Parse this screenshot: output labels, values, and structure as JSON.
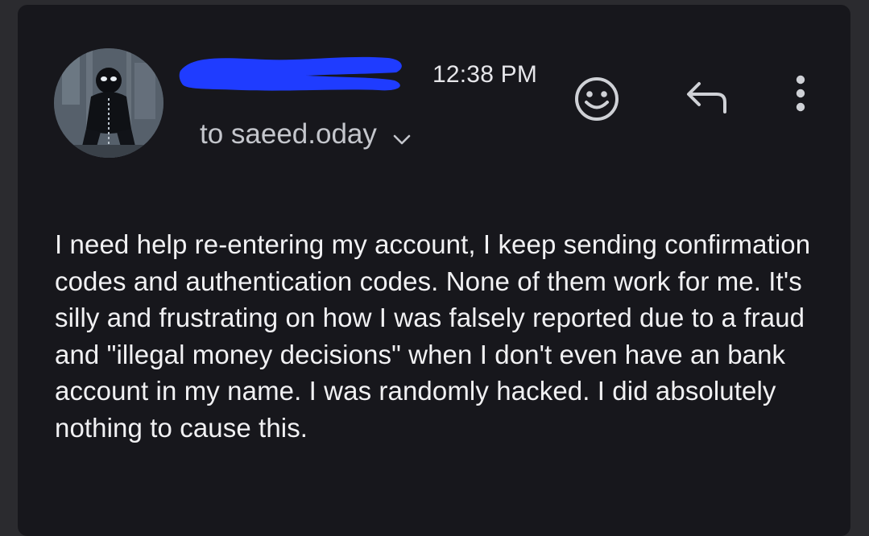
{
  "email": {
    "time": "12:38 PM",
    "recipient_label": "to saeed.oday",
    "body": "I need help re-entering my account, I keep sending confirmation codes and authentication codes. None of them work for me. It's silly and frustrating on how I was falsely reported due to a fraud and \"illegal money decisions\" when I don't even have an bank account in my name. I was randomly hacked. I did absolutely nothing to cause this."
  },
  "icons": {
    "expand_recipients": "chevron-down-icon",
    "add_reaction": "smiley-face-icon",
    "reply": "reply-arrow-icon",
    "more": "more-vertical-icon"
  },
  "colors": {
    "background": "#17171c",
    "text": "#f1f1f3",
    "secondary_text": "#c4c6cc",
    "redaction": "#1f3cff"
  }
}
